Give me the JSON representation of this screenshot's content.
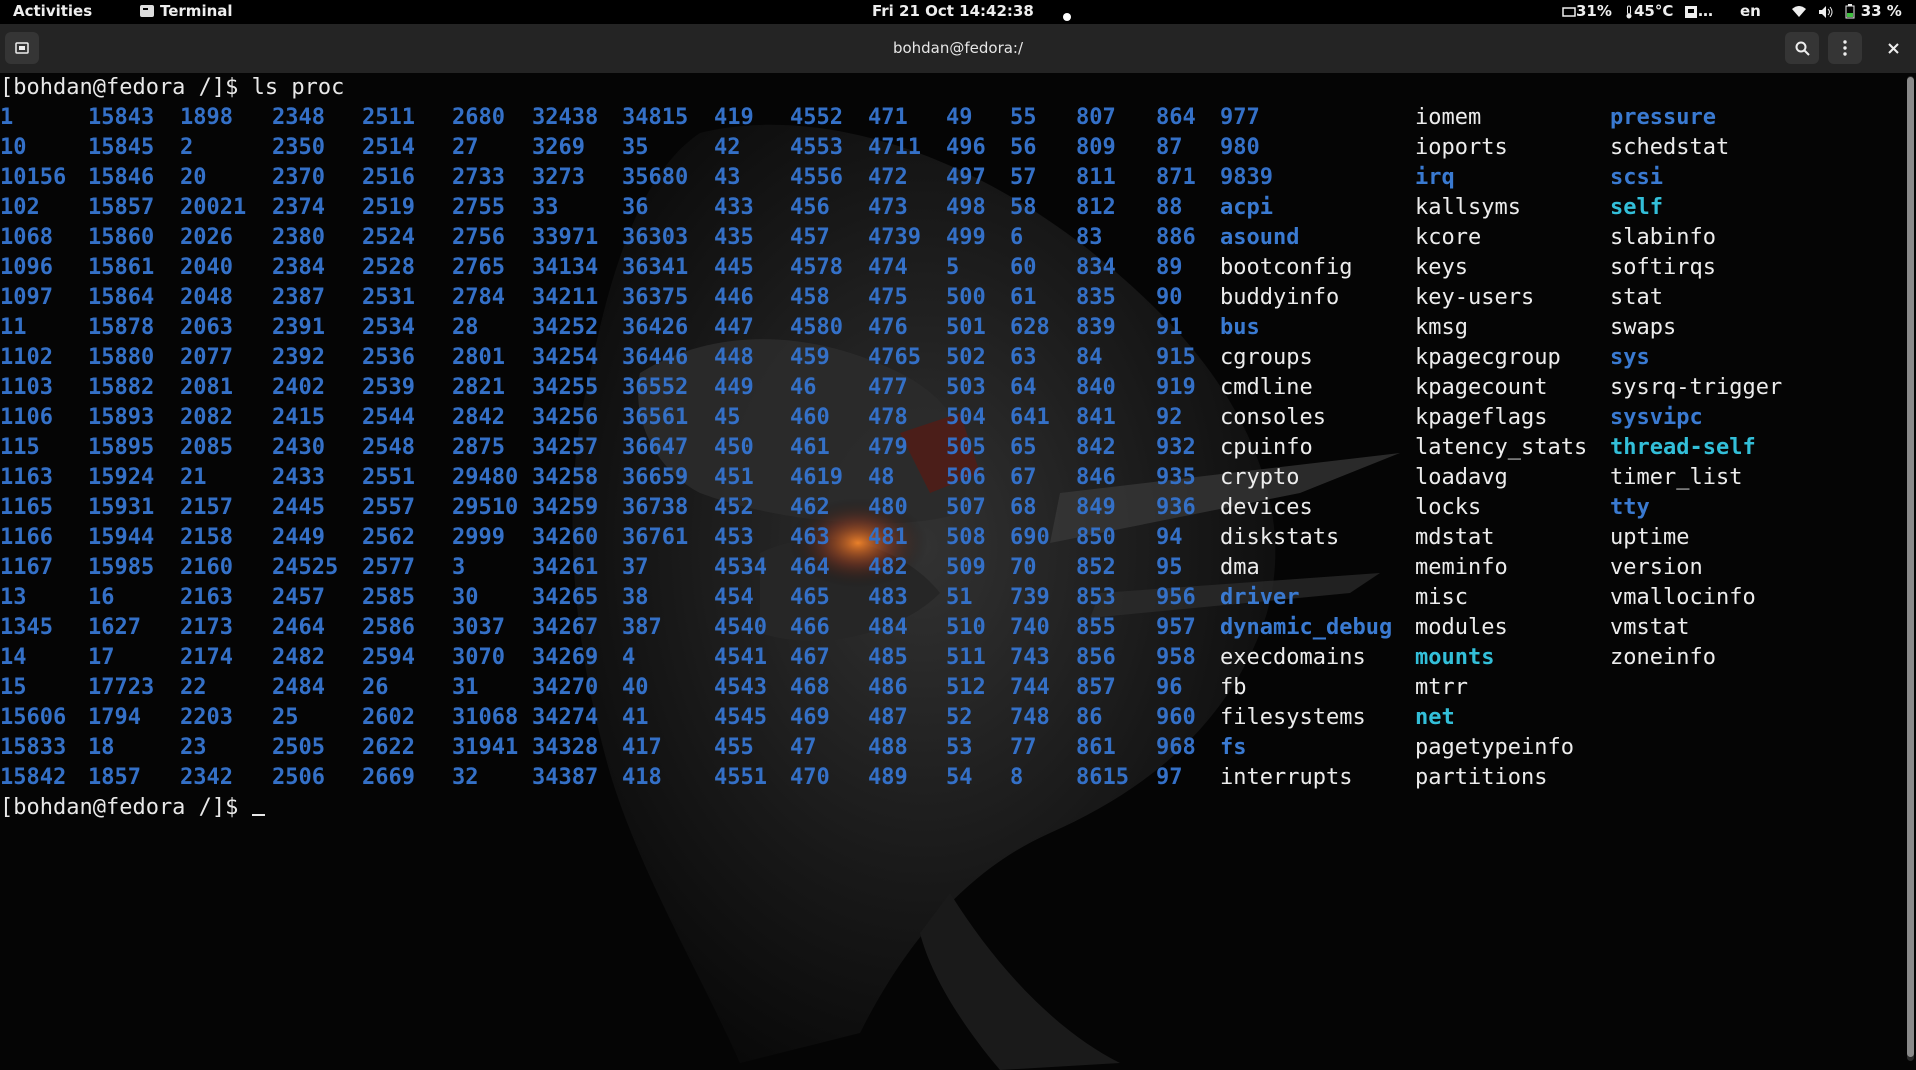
{
  "topbar": {
    "activities": "Activities",
    "app_name": "Terminal",
    "clock": "Fri 21 Oct  14:42:38",
    "cpu": "31%",
    "temp": "45°C",
    "disk": "…",
    "lang": "en",
    "battery": "33 %"
  },
  "window": {
    "title": "bohdan@fedora:/"
  },
  "terminal": {
    "prompt": "[bohdan@fedora /]$ ",
    "command": "ls proc",
    "columns": [
      {
        "class": "num",
        "items": [
          "1",
          "10",
          "10156",
          "102",
          "1068",
          "1096",
          "1097",
          "11",
          "1102",
          "1103",
          "1106",
          "115",
          "1163",
          "1165",
          "1166",
          "1167",
          "13",
          "1345",
          "14",
          "15",
          "15606",
          "15833",
          "15842"
        ]
      },
      {
        "class": "num",
        "items": [
          "15843",
          "15845",
          "15846",
          "15857",
          "15860",
          "15861",
          "15864",
          "15878",
          "15880",
          "15882",
          "15893",
          "15895",
          "15924",
          "15931",
          "15944",
          "15985",
          "16",
          "1627",
          "17",
          "17723",
          "1794",
          "18",
          "1857"
        ]
      },
      {
        "class": "num",
        "items": [
          "1898",
          "2",
          "20",
          "20021",
          "2026",
          "2040",
          "2048",
          "2063",
          "2077",
          "2081",
          "2082",
          "2085",
          "21",
          "2157",
          "2158",
          "2160",
          "2163",
          "2173",
          "2174",
          "22",
          "2203",
          "23",
          "2342"
        ]
      },
      {
        "class": "num",
        "items": [
          "2348",
          "2350",
          "2370",
          "2374",
          "2380",
          "2384",
          "2387",
          "2391",
          "2392",
          "2402",
          "2415",
          "2430",
          "2433",
          "2445",
          "2449",
          "24525",
          "2457",
          "2464",
          "2482",
          "2484",
          "25",
          "2505",
          "2506"
        ]
      },
      {
        "class": "num",
        "items": [
          "2511",
          "2514",
          "2516",
          "2519",
          "2524",
          "2528",
          "2531",
          "2534",
          "2536",
          "2539",
          "2544",
          "2548",
          "2551",
          "2557",
          "2562",
          "2577",
          "2585",
          "2586",
          "2594",
          "26",
          "2602",
          "2622",
          "2669"
        ]
      },
      {
        "class": "num",
        "items": [
          "2680",
          "27",
          "2733",
          "2755",
          "2756",
          "2765",
          "2784",
          "28",
          "2801",
          "2821",
          "2842",
          "2875",
          "29480",
          "29510",
          "2999",
          "3",
          "30",
          "3037",
          "3070",
          "31",
          "31068",
          "31941",
          "32"
        ]
      },
      {
        "class": "num",
        "items": [
          "32438",
          "3269",
          "3273",
          "33",
          "33971",
          "34134",
          "34211",
          "34252",
          "34254",
          "34255",
          "34256",
          "34257",
          "34258",
          "34259",
          "34260",
          "34261",
          "34265",
          "34267",
          "34269",
          "34270",
          "34274",
          "34328",
          "34387"
        ]
      },
      {
        "class": "num",
        "items": [
          "34815",
          "35",
          "35680",
          "36",
          "36303",
          "36341",
          "36375",
          "36426",
          "36446",
          "36552",
          "36561",
          "36647",
          "36659",
          "36738",
          "36761",
          "37",
          "38",
          "387",
          "4",
          "40",
          "41",
          "417",
          "418"
        ]
      },
      {
        "class": "num",
        "items": [
          "419",
          "42",
          "43",
          "433",
          "435",
          "445",
          "446",
          "447",
          "448",
          "449",
          "45",
          "450",
          "451",
          "452",
          "453",
          "4534",
          "454",
          "4540",
          "4541",
          "4543",
          "4545",
          "455",
          "4551"
        ]
      },
      {
        "class": "num",
        "items": [
          "4552",
          "4553",
          "4556",
          "456",
          "457",
          "4578",
          "458",
          "4580",
          "459",
          "46",
          "460",
          "461",
          "4619",
          "462",
          "463",
          "464",
          "465",
          "466",
          "467",
          "468",
          "469",
          "47",
          "470"
        ]
      },
      {
        "class": "num",
        "items": [
          "471",
          "4711",
          "472",
          "473",
          "4739",
          "474",
          "475",
          "476",
          "4765",
          "477",
          "478",
          "479",
          "48",
          "480",
          "481",
          "482",
          "483",
          "484",
          "485",
          "486",
          "487",
          "488",
          "489"
        ]
      },
      {
        "class": "num",
        "items": [
          "49",
          "496",
          "497",
          "498",
          "499",
          "5",
          "500",
          "501",
          "502",
          "503",
          "504",
          "505",
          "506",
          "507",
          "508",
          "509",
          "51",
          "510",
          "511",
          "512",
          "52",
          "53",
          "54"
        ]
      },
      {
        "class": "num",
        "items": [
          "55",
          "56",
          "57",
          "58",
          "6",
          "60",
          "61",
          "628",
          "63",
          "64",
          "641",
          "65",
          "67",
          "68",
          "690",
          "70",
          "739",
          "740",
          "743",
          "744",
          "748",
          "77",
          "8"
        ]
      },
      {
        "class": "num",
        "items": [
          "807",
          "809",
          "811",
          "812",
          "83",
          "834",
          "835",
          "839",
          "84",
          "840",
          "841",
          "842",
          "846",
          "849",
          "850",
          "852",
          "853",
          "855",
          "856",
          "857",
          "86",
          "861",
          "8615"
        ]
      },
      {
        "class": "num",
        "items": [
          "864",
          "87",
          "871",
          "88",
          "886",
          "89",
          "90",
          "91",
          "915",
          "919",
          "92",
          "932",
          "935",
          "936",
          "94",
          "95",
          "956",
          "957",
          "958",
          "96",
          "960",
          "968",
          "97"
        ]
      },
      {
        "class": "mixed",
        "items": [
          {
            "t": "977",
            "c": "num"
          },
          {
            "t": "980",
            "c": "num"
          },
          {
            "t": "9839",
            "c": "num"
          },
          {
            "t": "acpi",
            "c": "dir"
          },
          {
            "t": "asound",
            "c": "dir"
          },
          {
            "t": "bootconfig",
            "c": "file"
          },
          {
            "t": "buddyinfo",
            "c": "file"
          },
          {
            "t": "bus",
            "c": "dir"
          },
          {
            "t": "cgroups",
            "c": "file"
          },
          {
            "t": "cmdline",
            "c": "file"
          },
          {
            "t": "consoles",
            "c": "file"
          },
          {
            "t": "cpuinfo",
            "c": "file"
          },
          {
            "t": "crypto",
            "c": "file"
          },
          {
            "t": "devices",
            "c": "file"
          },
          {
            "t": "diskstats",
            "c": "file"
          },
          {
            "t": "dma",
            "c": "file"
          },
          {
            "t": "driver",
            "c": "dir"
          },
          {
            "t": "dynamic_debug",
            "c": "dir"
          },
          {
            "t": "execdomains",
            "c": "file"
          },
          {
            "t": "fb",
            "c": "file"
          },
          {
            "t": "filesystems",
            "c": "file"
          },
          {
            "t": "fs",
            "c": "dir"
          },
          {
            "t": "interrupts",
            "c": "file"
          }
        ]
      },
      {
        "class": "mixed",
        "items": [
          {
            "t": "iomem",
            "c": "file"
          },
          {
            "t": "ioports",
            "c": "file"
          },
          {
            "t": "irq",
            "c": "dir"
          },
          {
            "t": "kallsyms",
            "c": "file"
          },
          {
            "t": "kcore",
            "c": "file"
          },
          {
            "t": "keys",
            "c": "file"
          },
          {
            "t": "key-users",
            "c": "file"
          },
          {
            "t": "kmsg",
            "c": "file"
          },
          {
            "t": "kpagecgroup",
            "c": "file"
          },
          {
            "t": "kpagecount",
            "c": "file"
          },
          {
            "t": "kpageflags",
            "c": "file"
          },
          {
            "t": "latency_stats",
            "c": "file"
          },
          {
            "t": "loadavg",
            "c": "file"
          },
          {
            "t": "locks",
            "c": "file"
          },
          {
            "t": "mdstat",
            "c": "file"
          },
          {
            "t": "meminfo",
            "c": "file"
          },
          {
            "t": "misc",
            "c": "file"
          },
          {
            "t": "modules",
            "c": "file"
          },
          {
            "t": "mounts",
            "c": "cyan"
          },
          {
            "t": "mtrr",
            "c": "file"
          },
          {
            "t": "net",
            "c": "cyan"
          },
          {
            "t": "pagetypeinfo",
            "c": "file"
          },
          {
            "t": "partitions",
            "c": "file"
          }
        ]
      },
      {
        "class": "mixed",
        "items": [
          {
            "t": "pressure",
            "c": "dir"
          },
          {
            "t": "schedstat",
            "c": "file"
          },
          {
            "t": "scsi",
            "c": "dir"
          },
          {
            "t": "self",
            "c": "cyan"
          },
          {
            "t": "slabinfo",
            "c": "file"
          },
          {
            "t": "softirqs",
            "c": "file"
          },
          {
            "t": "stat",
            "c": "file"
          },
          {
            "t": "swaps",
            "c": "file"
          },
          {
            "t": "sys",
            "c": "dir"
          },
          {
            "t": "sysrq-trigger",
            "c": "file"
          },
          {
            "t": "sysvipc",
            "c": "dir"
          },
          {
            "t": "thread-self",
            "c": "cyan"
          },
          {
            "t": "timer_list",
            "c": "file"
          },
          {
            "t": "tty",
            "c": "dir"
          },
          {
            "t": "uptime",
            "c": "file"
          },
          {
            "t": "version",
            "c": "file"
          },
          {
            "t": "vmallocinfo",
            "c": "file"
          },
          {
            "t": "vmstat",
            "c": "file"
          },
          {
            "t": "zoneinfo",
            "c": "file"
          }
        ]
      }
    ],
    "final_prompt": "[bohdan@fedora /]$ "
  },
  "colors": {
    "number": "#3470c7",
    "directory": "#3a7ad1",
    "file": "#ececec",
    "link": "#33bfd9"
  }
}
